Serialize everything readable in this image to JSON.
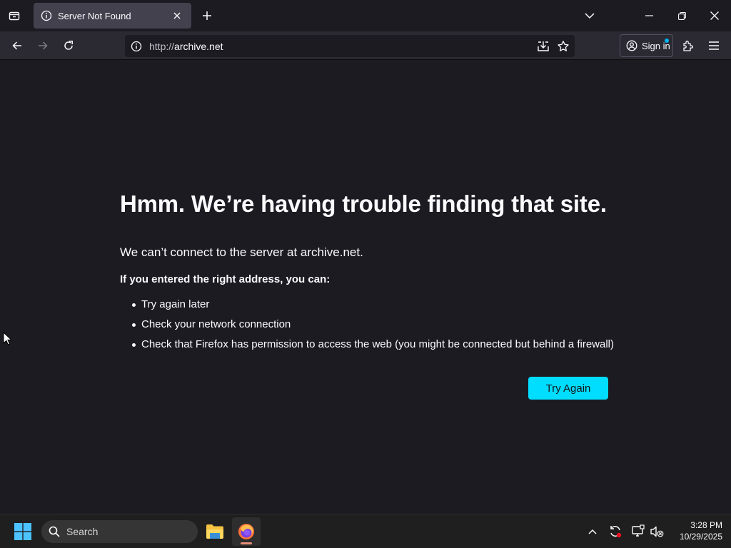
{
  "tab": {
    "title": "Server Not Found"
  },
  "navigation": {
    "url_scheme": "http://",
    "url_host": "archive.net",
    "sign_in_label": "Sign in"
  },
  "error_page": {
    "title": "Hmm. We’re having trouble finding that site.",
    "description": "We can’t connect to the server at archive.net.",
    "advice_heading": "If you entered the right address, you can:",
    "advice_items": [
      "Try again later",
      "Check your network connection",
      "Check that Firefox has permission to access the web (you might be connected but behind a firewall)"
    ],
    "try_again_label": "Try Again"
  },
  "taskbar": {
    "search_label": "Search",
    "time": "3:28 PM",
    "date": "10/29/2025",
    "apps": [
      "folder-icon",
      "firefox-icon"
    ]
  },
  "colors": {
    "accent": "#00ddff",
    "page_background": "#1c1b22",
    "toolbar_background": "#2b2a33",
    "tab_active": "#42414d"
  }
}
